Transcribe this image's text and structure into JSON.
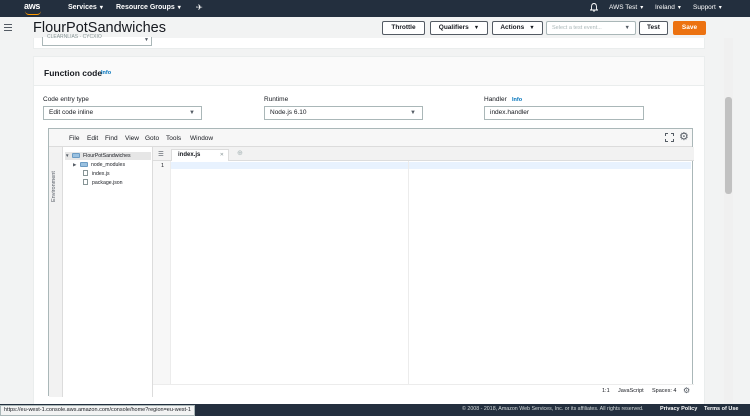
{
  "nav": {
    "logo": "aws",
    "services": "Services",
    "resource_groups": "Resource Groups",
    "account": "AWS Test",
    "region": "Ireland",
    "support": "Support",
    "caret": "▾",
    "pin_icon": "✈"
  },
  "header": {
    "title": "FlourPotSandwiches",
    "throttle": "Throttle",
    "qualifiers": "Qualifiers",
    "actions": "Actions",
    "test_event_placeholder": "Select a test event...",
    "test": "Test",
    "save": "Save",
    "tri": "▼"
  },
  "top_select": {
    "text": "CLEARNLIAS · CYCXIO"
  },
  "function_code": {
    "title": "Function code",
    "info": "Info",
    "code_entry_label": "Code entry type",
    "code_entry_value": "Edit code inline",
    "runtime_label": "Runtime",
    "runtime_value": "Node.js 6.10",
    "handler_label": "Handler",
    "handler_info": "Info",
    "handler_value": "index.handler"
  },
  "editor": {
    "menu": [
      "File",
      "Edit",
      "Find",
      "View",
      "Goto",
      "Tools",
      "Window"
    ],
    "environment_tab": "Environment",
    "tree": {
      "root": "FlourPotSandwiches",
      "node_modules": "node_modules",
      "index": "index.js",
      "package": "package.json"
    },
    "file_tab": "index.js",
    "line_number": "1",
    "status_position": "1:1",
    "status_language": "JavaScript",
    "status_spaces": "Spaces: 4"
  },
  "footer": {
    "copyright": "© 2008 - 2018, Amazon Web Services, Inc. or its affiliates. All rights reserved.",
    "privacy": "Privacy Policy",
    "terms": "Terms of Use"
  },
  "status_url": "https://eu-west-1.console.aws.amazon.com/console/home?region=eu-west-1"
}
